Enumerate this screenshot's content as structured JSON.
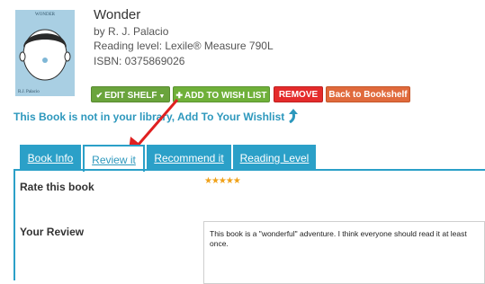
{
  "book": {
    "cover_title": "WONDER",
    "cover_author": "R.J. Palacio",
    "title": "Wonder",
    "author_line": "by R. J. Palacio",
    "reading_level": "Reading level: Lexile® Measure 790L",
    "isbn": "ISBN: 0375869026"
  },
  "buttons": {
    "edit_shelf": "EDIT SHELF",
    "add_wishlist": "ADD TO WISH LIST",
    "remove": "REMOVE",
    "back": "Back to Bookshelf"
  },
  "notice": "This Book is not in your library, Add To Your Wishlist",
  "tabs": [
    {
      "label": "Book Info"
    },
    {
      "label": "Review it"
    },
    {
      "label": "Recommend it"
    },
    {
      "label": "Reading Level"
    }
  ],
  "review": {
    "rate_label": "Rate this book",
    "rating": 5,
    "stars": "★★★★★",
    "your_review_label": "Your Review",
    "text": "This book is a \"wonderful\" adventure. I think everyone should read it at least once."
  },
  "colors": {
    "accent": "#2ba0c8",
    "green": "#6aa43c",
    "red": "#e42b2b",
    "orange": "#e06a3c",
    "star": "#f0a21a"
  }
}
